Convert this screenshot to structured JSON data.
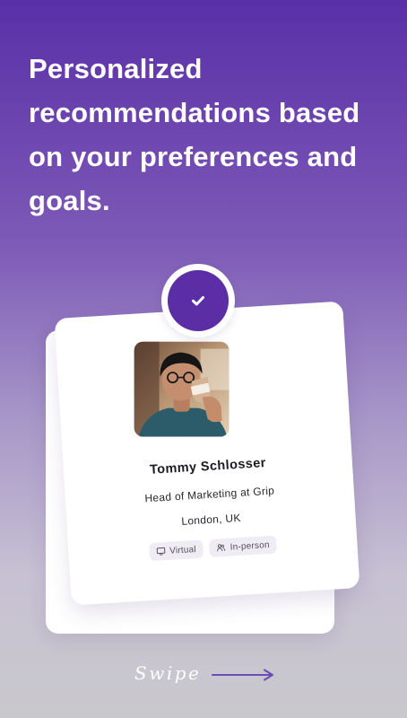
{
  "onboarding": {
    "headline": "Personalized recommendations based on your preferences and goals."
  },
  "profile_card": {
    "name": "Tommy Schlosser",
    "title": "Head of Marketing at Grip",
    "location": "London, UK",
    "tags": [
      {
        "label": "Virtual",
        "icon": "monitor-icon"
      },
      {
        "label": "In-person",
        "icon": "people-icon"
      }
    ]
  },
  "navigation": {
    "swipe_label": "Swipe",
    "swipe_icon": "arrow-right-icon"
  },
  "colors": {
    "primary": "#5b2ea5",
    "background_top": "#5a2fa7",
    "background_bottom": "#c9c8cc",
    "card": "#ffffff",
    "tag_bg": "#efedf3",
    "swipe_arrow": "#6a4db3"
  }
}
